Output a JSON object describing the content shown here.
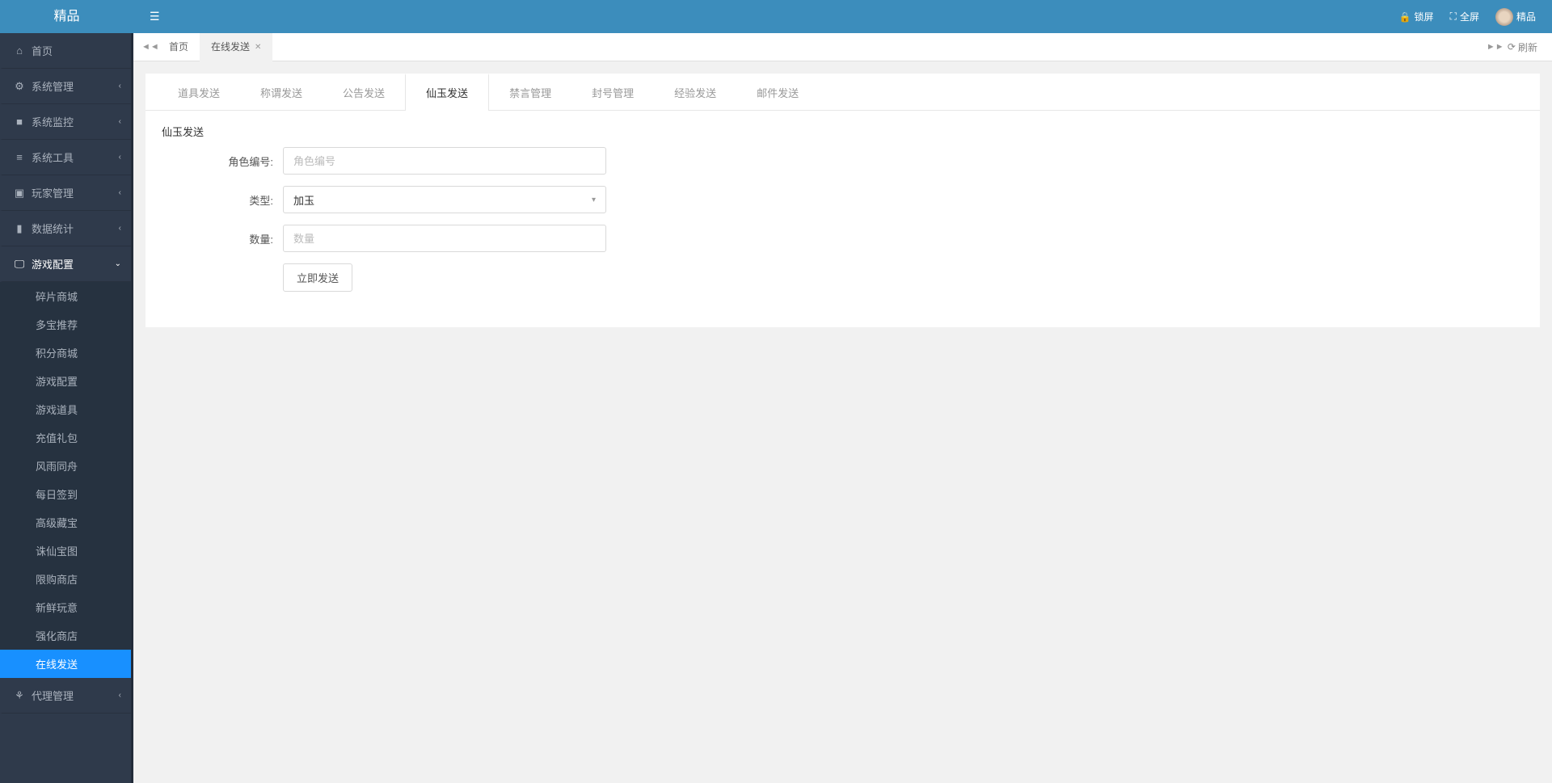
{
  "brand": "精品",
  "header": {
    "lock": "锁屏",
    "fullscreen": "全屏",
    "user": "精品"
  },
  "sidebar": {
    "home": "首页",
    "items": [
      {
        "icon": "⚙",
        "label": "系统管理"
      },
      {
        "icon": "■",
        "label": "系统监控"
      },
      {
        "icon": "≡",
        "label": "系统工具"
      },
      {
        "icon": "▣",
        "label": "玩家管理"
      },
      {
        "icon": "▮",
        "label": "数据统计"
      }
    ],
    "game_config": {
      "icon": "🖵",
      "label": "游戏配置"
    },
    "game_config_children": [
      "碎片商城",
      "多宝推荐",
      "积分商城",
      "游戏配置",
      "游戏道具",
      "充值礼包",
      "风雨同舟",
      "每日签到",
      "高级藏宝",
      "诛仙宝图",
      "限购商店",
      "新鲜玩意",
      "强化商店",
      "在线发送"
    ],
    "agent": {
      "icon": "⚘",
      "label": "代理管理"
    }
  },
  "page_tabs": {
    "home": "首页",
    "current": "在线发送",
    "refresh": "刷新"
  },
  "sub_tabs": [
    "道具发送",
    "称谓发送",
    "公告发送",
    "仙玉发送",
    "禁言管理",
    "封号管理",
    "经验发送",
    "邮件发送"
  ],
  "active_sub_tab_index": 3,
  "form": {
    "section_title": "仙玉发送",
    "role_label": "角色编号:",
    "role_placeholder": "角色编号",
    "type_label": "类型:",
    "type_value": "加玉",
    "qty_label": "数量:",
    "qty_placeholder": "数量",
    "submit": "立即发送"
  }
}
